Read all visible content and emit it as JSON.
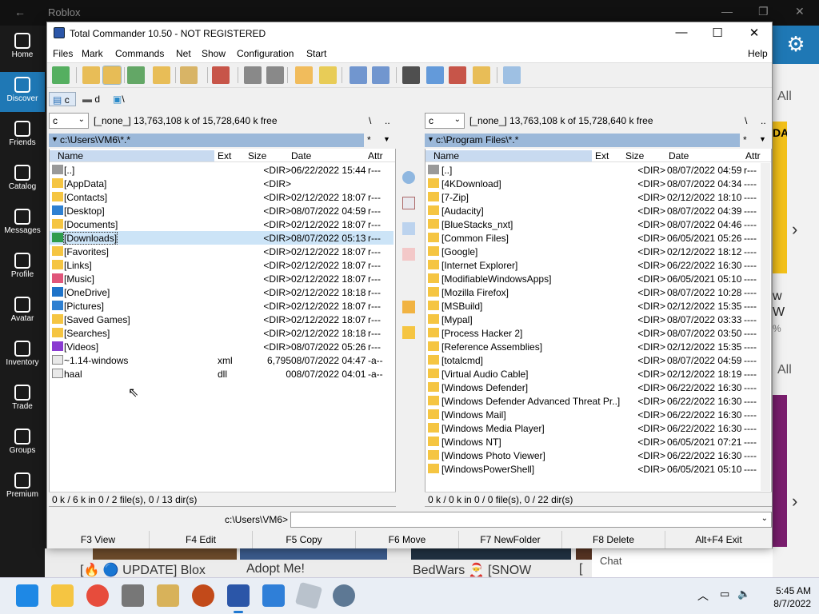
{
  "roblox": {
    "title": "Roblox",
    "sidebar": [
      {
        "label": "Home",
        "icon": "home-icon"
      },
      {
        "label": "Discover",
        "icon": "gamepad-icon",
        "active": true
      },
      {
        "label": "Friends",
        "icon": "friends-icon"
      },
      {
        "label": "Catalog",
        "icon": "cart-icon"
      },
      {
        "label": "Messages",
        "icon": "message-icon"
      },
      {
        "label": "Profile",
        "icon": "profile-icon"
      },
      {
        "label": "Avatar",
        "icon": "avatar-icon"
      },
      {
        "label": "Inventory",
        "icon": "inventory-icon"
      },
      {
        "label": "Trade",
        "icon": "trade-icon"
      },
      {
        "label": "Groups",
        "icon": "groups-icon"
      },
      {
        "label": "Premium",
        "icon": "premium-icon"
      }
    ],
    "right_all_1": "All",
    "right_all_2": "All",
    "right_text_1": "DA",
    "right_text_2": "w",
    "right_text_3": "W",
    "right_text_4": "%",
    "bottom": [
      "[🔥 🔵 UPDATE] Blox",
      "Adopt Me!",
      "BedWars 🎅 [SNOW",
      "["
    ],
    "chat": "Chat"
  },
  "tc": {
    "title": "Total Commander 10.50 - NOT REGISTERED",
    "menu": [
      "Files",
      "Mark",
      "Commands",
      "Net",
      "Show",
      "Configuration",
      "Start",
      "Help"
    ],
    "drives": [
      "c",
      "d",
      "\\"
    ],
    "left": {
      "drive": "c",
      "info": "[_none_]  13,763,108 k of 15,728,640 k free",
      "root": "\\",
      "up": "..",
      "path": "c:\\Users\\VM6\\*.*",
      "star": "*",
      "cols": [
        "Name",
        "Ext",
        "Size",
        "Date",
        "Attr"
      ],
      "rows": [
        {
          "name": "[..]",
          "ext": "",
          "size": "<DIR>",
          "date": "06/22/2022 15:44",
          "attr": "r---",
          "icon": "up-dir-icon"
        },
        {
          "name": "[AppData]",
          "ext": "",
          "size": "<DIR>",
          "date": "",
          "attr": "",
          "icon": "folder-icon"
        },
        {
          "name": "[Contacts]",
          "ext": "",
          "size": "<DIR>",
          "date": "02/12/2022 18:07",
          "attr": "r---",
          "icon": "folder-icon"
        },
        {
          "name": "[Desktop]",
          "ext": "",
          "size": "<DIR>",
          "date": "08/07/2022 04:59",
          "attr": "r---",
          "icon": "desktop-icon"
        },
        {
          "name": "[Documents]",
          "ext": "",
          "size": "<DIR>",
          "date": "02/12/2022 18:07",
          "attr": "r---",
          "icon": "folder-icon"
        },
        {
          "name": "[Downloads]",
          "ext": "",
          "size": "<DIR>",
          "date": "08/07/2022 05:13",
          "attr": "r---",
          "icon": "download-icon",
          "selected": true
        },
        {
          "name": "[Favorites]",
          "ext": "",
          "size": "<DIR>",
          "date": "02/12/2022 18:07",
          "attr": "r---",
          "icon": "folder-icon"
        },
        {
          "name": "[Links]",
          "ext": "",
          "size": "<DIR>",
          "date": "02/12/2022 18:07",
          "attr": "r---",
          "icon": "folder-icon"
        },
        {
          "name": "[Music]",
          "ext": "",
          "size": "<DIR>",
          "date": "02/12/2022 18:07",
          "attr": "r---",
          "icon": "music-icon"
        },
        {
          "name": "[OneDrive]",
          "ext": "",
          "size": "<DIR>",
          "date": "02/12/2022 18:18",
          "attr": "r---",
          "icon": "cloud-icon"
        },
        {
          "name": "[Pictures]",
          "ext": "",
          "size": "<DIR>",
          "date": "02/12/2022 18:07",
          "attr": "r---",
          "icon": "pictures-icon"
        },
        {
          "name": "[Saved Games]",
          "ext": "",
          "size": "<DIR>",
          "date": "02/12/2022 18:07",
          "attr": "r---",
          "icon": "folder-icon"
        },
        {
          "name": "[Searches]",
          "ext": "",
          "size": "<DIR>",
          "date": "02/12/2022 18:18",
          "attr": "r---",
          "icon": "folder-icon"
        },
        {
          "name": "[Videos]",
          "ext": "",
          "size": "<DIR>",
          "date": "08/07/2022 05:26",
          "attr": "r---",
          "icon": "videos-icon"
        },
        {
          "name": "~1.14-windows",
          "ext": "xml",
          "size": "6,795",
          "date": "08/07/2022 04:47",
          "attr": "-a--",
          "icon": "file-icon"
        },
        {
          "name": "haal",
          "ext": "dll",
          "size": "0",
          "date": "08/07/2022 04:01",
          "attr": "-a--",
          "icon": "file-icon"
        }
      ],
      "status": "0 k / 6 k in 0 / 2 file(s), 0 / 13 dir(s)"
    },
    "right": {
      "drive": "c",
      "info": "[_none_]  13,763,108 k of 15,728,640 k free",
      "root": "\\",
      "up": "..",
      "path": "c:\\Program Files\\*.*",
      "star": "*",
      "cols": [
        "Name",
        "Ext",
        "Size",
        "Date",
        "Attr"
      ],
      "rows": [
        {
          "name": "[..]",
          "size": "<DIR>",
          "date": "08/07/2022 04:59",
          "attr": "r---",
          "icon": "up-dir-icon"
        },
        {
          "name": "[4KDownload]",
          "size": "<DIR>",
          "date": "08/07/2022 04:34",
          "attr": "----",
          "icon": "folder-icon"
        },
        {
          "name": "[7-Zip]",
          "size": "<DIR>",
          "date": "02/12/2022 18:10",
          "attr": "----",
          "icon": "folder-icon"
        },
        {
          "name": "[Audacity]",
          "size": "<DIR>",
          "date": "08/07/2022 04:39",
          "attr": "----",
          "icon": "folder-icon"
        },
        {
          "name": "[BlueStacks_nxt]",
          "size": "<DIR>",
          "date": "08/07/2022 04:46",
          "attr": "----",
          "icon": "folder-icon"
        },
        {
          "name": "[Common Files]",
          "size": "<DIR>",
          "date": "06/05/2021 05:26",
          "attr": "----",
          "icon": "folder-icon"
        },
        {
          "name": "[Google]",
          "size": "<DIR>",
          "date": "02/12/2022 18:12",
          "attr": "----",
          "icon": "folder-icon"
        },
        {
          "name": "[Internet Explorer]",
          "size": "<DIR>",
          "date": "06/22/2022 16:30",
          "attr": "----",
          "icon": "folder-icon"
        },
        {
          "name": "[ModifiableWindowsApps]",
          "size": "<DIR>",
          "date": "06/05/2021 05:10",
          "attr": "----",
          "icon": "folder-icon"
        },
        {
          "name": "[Mozilla Firefox]",
          "size": "<DIR>",
          "date": "08/07/2022 10:28",
          "attr": "----",
          "icon": "folder-icon"
        },
        {
          "name": "[MSBuild]",
          "size": "<DIR>",
          "date": "02/12/2022 15:35",
          "attr": "----",
          "icon": "folder-icon"
        },
        {
          "name": "[Mypal]",
          "size": "<DIR>",
          "date": "08/07/2022 03:33",
          "attr": "----",
          "icon": "folder-icon"
        },
        {
          "name": "[Process Hacker 2]",
          "size": "<DIR>",
          "date": "08/07/2022 03:50",
          "attr": "----",
          "icon": "folder-icon"
        },
        {
          "name": "[Reference Assemblies]",
          "size": "<DIR>",
          "date": "02/12/2022 15:35",
          "attr": "----",
          "icon": "folder-icon"
        },
        {
          "name": "[totalcmd]",
          "size": "<DIR>",
          "date": "08/07/2022 04:59",
          "attr": "----",
          "icon": "folder-icon"
        },
        {
          "name": "[Virtual Audio Cable]",
          "size": "<DIR>",
          "date": "02/12/2022 18:19",
          "attr": "----",
          "icon": "folder-icon"
        },
        {
          "name": "[Windows Defender]",
          "size": "<DIR>",
          "date": "06/22/2022 16:30",
          "attr": "----",
          "icon": "folder-icon"
        },
        {
          "name": "[Windows Defender Advanced Threat Pr..]",
          "size": "<DIR>",
          "date": "06/22/2022 16:30",
          "attr": "----",
          "icon": "folder-icon"
        },
        {
          "name": "[Windows Mail]",
          "size": "<DIR>",
          "date": "06/22/2022 16:30",
          "attr": "----",
          "icon": "folder-icon"
        },
        {
          "name": "[Windows Media Player]",
          "size": "<DIR>",
          "date": "06/22/2022 16:30",
          "attr": "----",
          "icon": "folder-icon"
        },
        {
          "name": "[Windows NT]",
          "size": "<DIR>",
          "date": "06/05/2021 07:21",
          "attr": "----",
          "icon": "folder-icon"
        },
        {
          "name": "[Windows Photo Viewer]",
          "size": "<DIR>",
          "date": "06/22/2022 16:30",
          "attr": "----",
          "icon": "folder-icon"
        },
        {
          "name": "[WindowsPowerShell]",
          "size": "<DIR>",
          "date": "06/05/2021 05:10",
          "attr": "----",
          "icon": "folder-icon"
        }
      ],
      "status": "0 k / 0 k in 0 / 0 file(s), 0 / 22 dir(s)"
    },
    "cmd_prompt": "c:\\Users\\VM6>",
    "fkeys": [
      "F3 View",
      "F4 Edit",
      "F5 Copy",
      "F6 Move",
      "F7 NewFolder",
      "F8 Delete",
      "Alt+F4 Exit"
    ]
  },
  "taskbar": {
    "time": "5:45 AM",
    "date": "8/7/2022"
  }
}
